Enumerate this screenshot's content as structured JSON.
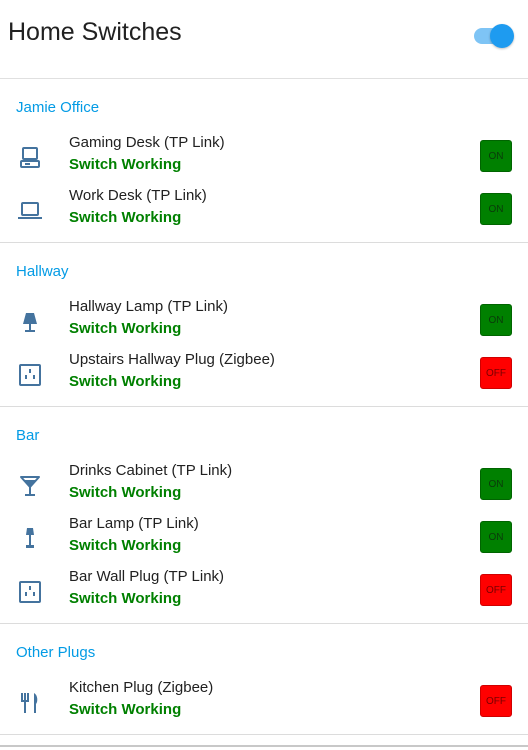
{
  "header": {
    "title": "Home Switches",
    "master_toggle_on": true,
    "accent_color": "#1e9bf0"
  },
  "colors": {
    "section_title": "#039be5",
    "status_ok": "#008000",
    "on": "#008000",
    "off": "#ff0000",
    "icon": "#44739e"
  },
  "sections": [
    {
      "title": "Jamie Office",
      "items": [
        {
          "icon": "desktop-computer-icon",
          "name": "Gaming Desk (TP Link)",
          "status": "Switch Working",
          "state": "ON"
        },
        {
          "icon": "laptop-icon",
          "name": "Work Desk (TP Link)",
          "status": "Switch Working",
          "state": "ON"
        }
      ]
    },
    {
      "title": "Hallway",
      "items": [
        {
          "icon": "floor-lamp-icon",
          "name": "Hallway Lamp (TP Link)",
          "status": "Switch Working",
          "state": "ON"
        },
        {
          "icon": "power-socket-icon",
          "name": "Upstairs Hallway Plug (Zigbee)",
          "status": "Switch Working",
          "state": "OFF"
        }
      ]
    },
    {
      "title": "Bar",
      "items": [
        {
          "icon": "cocktail-glass-icon",
          "name": "Drinks Cabinet (TP Link)",
          "status": "Switch Working",
          "state": "ON"
        },
        {
          "icon": "table-lamp-icon",
          "name": "Bar Lamp (TP Link)",
          "status": "Switch Working",
          "state": "ON"
        },
        {
          "icon": "power-socket-icon",
          "name": "Bar Wall Plug (TP Link)",
          "status": "Switch Working",
          "state": "OFF"
        }
      ]
    },
    {
      "title": "Other Plugs",
      "items": [
        {
          "icon": "cutlery-icon",
          "name": "Kitchen Plug (Zigbee)",
          "status": "Switch Working",
          "state": "OFF"
        }
      ]
    }
  ]
}
